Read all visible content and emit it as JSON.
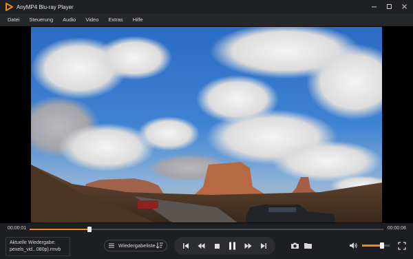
{
  "app": {
    "title": "AnyMP4 Blu-ray Player",
    "accent": "#f08a1c"
  },
  "window_controls": [
    "minimize-icon",
    "maximize-icon",
    "close-icon"
  ],
  "menu": [
    "Datei",
    "Steuerung",
    "Audio",
    "Video",
    "Extras",
    "Hilfe"
  ],
  "player": {
    "current_time": "00:00:01",
    "total_time": "00:00:06",
    "progress": 0.17,
    "volume": 0.72
  },
  "now_playing": {
    "label": "Aktuelle Wiedergabe:",
    "file": "pexels_vid...080p).rmvb"
  },
  "playlist": {
    "label": "Wiedergabeliste"
  },
  "transport_icons": [
    "skip-previous-icon",
    "rewind-icon",
    "stop-icon",
    "pause-icon",
    "fast-forward-icon",
    "skip-next-icon"
  ],
  "tool_icons": [
    "snapshot-camera-icon",
    "open-folder-icon",
    "volume-icon",
    "fullscreen-icon"
  ]
}
